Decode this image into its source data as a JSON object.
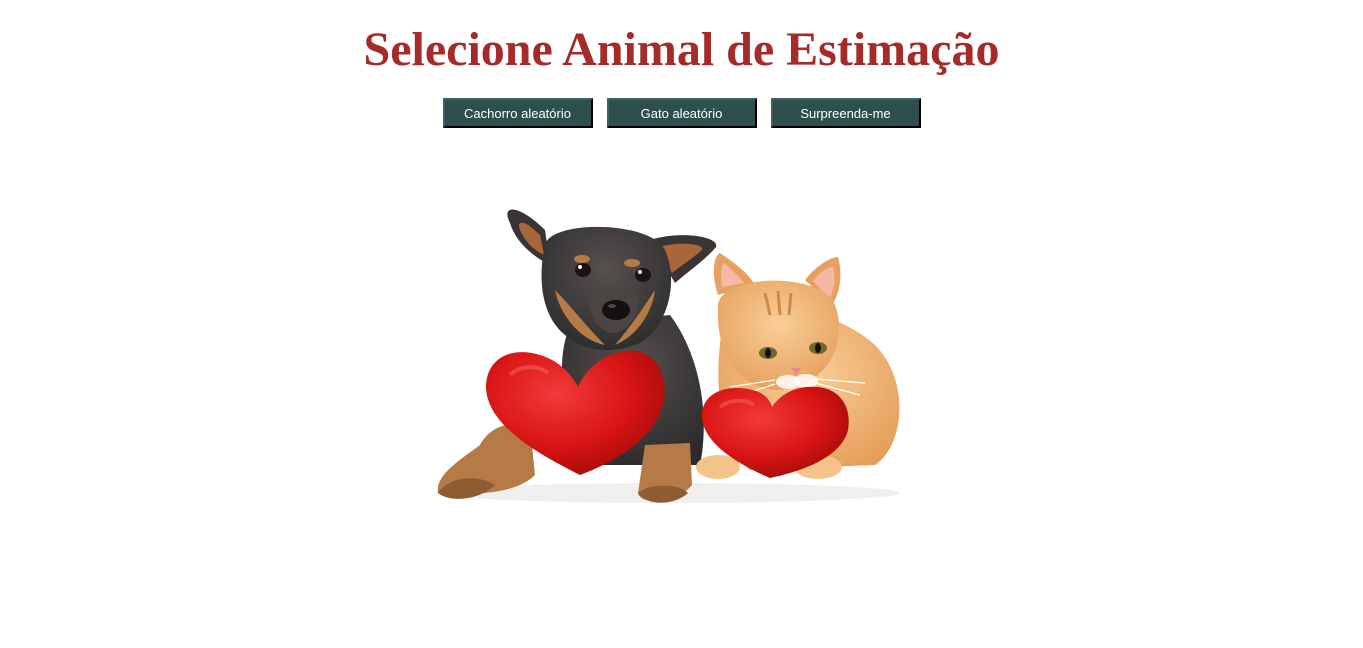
{
  "header": {
    "title": "Selecione Animal de Estimação"
  },
  "buttons": [
    {
      "label": "Cachorro aleatório"
    },
    {
      "label": "Gato aleatório"
    },
    {
      "label": "Surpreenda-me"
    }
  ],
  "image": {
    "subject": "puppy and kitten with red plush hearts",
    "colors": {
      "heart": "#d81414",
      "dog_coat": "#3d3a3c",
      "dog_tan": "#b57a45",
      "cat_coat": "#f0b070"
    }
  },
  "colors": {
    "title": "#a52a2a",
    "button_bg": "#2f4f4f",
    "button_text": "#ffffff"
  }
}
